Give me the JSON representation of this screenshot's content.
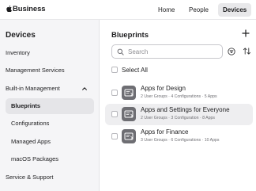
{
  "brand": {
    "name": "Business",
    "logo_icon": "apple-logo-icon"
  },
  "topnav": {
    "items": [
      {
        "label": "Home"
      },
      {
        "label": "People"
      },
      {
        "label": "Devices",
        "selected": true
      }
    ]
  },
  "sidebar": {
    "title": "Devices",
    "items": [
      {
        "label": "Inventory"
      },
      {
        "label": "Management Services"
      },
      {
        "label": "Built-in Management",
        "expanded": true
      }
    ],
    "subitems": [
      {
        "label": "Blueprints",
        "selected": true
      },
      {
        "label": "Configurations"
      },
      {
        "label": "Managed Apps"
      },
      {
        "label": "macOS Packages"
      }
    ],
    "footer_item": {
      "label": "Service & Support"
    }
  },
  "main": {
    "title": "Blueprints",
    "search": {
      "placeholder": "Search",
      "value": ""
    },
    "select_all_label": "Select All",
    "blueprints": [
      {
        "name": "Apps for Design",
        "meta": "2 User Groups · 4 Configurations · 5 Apps"
      },
      {
        "name": "Apps and Settings for Everyone",
        "meta": "2 User Groups · 3 Configuration · 8 Apps"
      },
      {
        "name": "Apps for Finance",
        "meta": "3 User Groups · 6 Configurations · 10 Apps"
      }
    ]
  },
  "colors": {
    "accent_gray": "#6e6e73",
    "sidebar_bg": "#f5f5f7",
    "selected_bg": "#e5e5e8"
  }
}
